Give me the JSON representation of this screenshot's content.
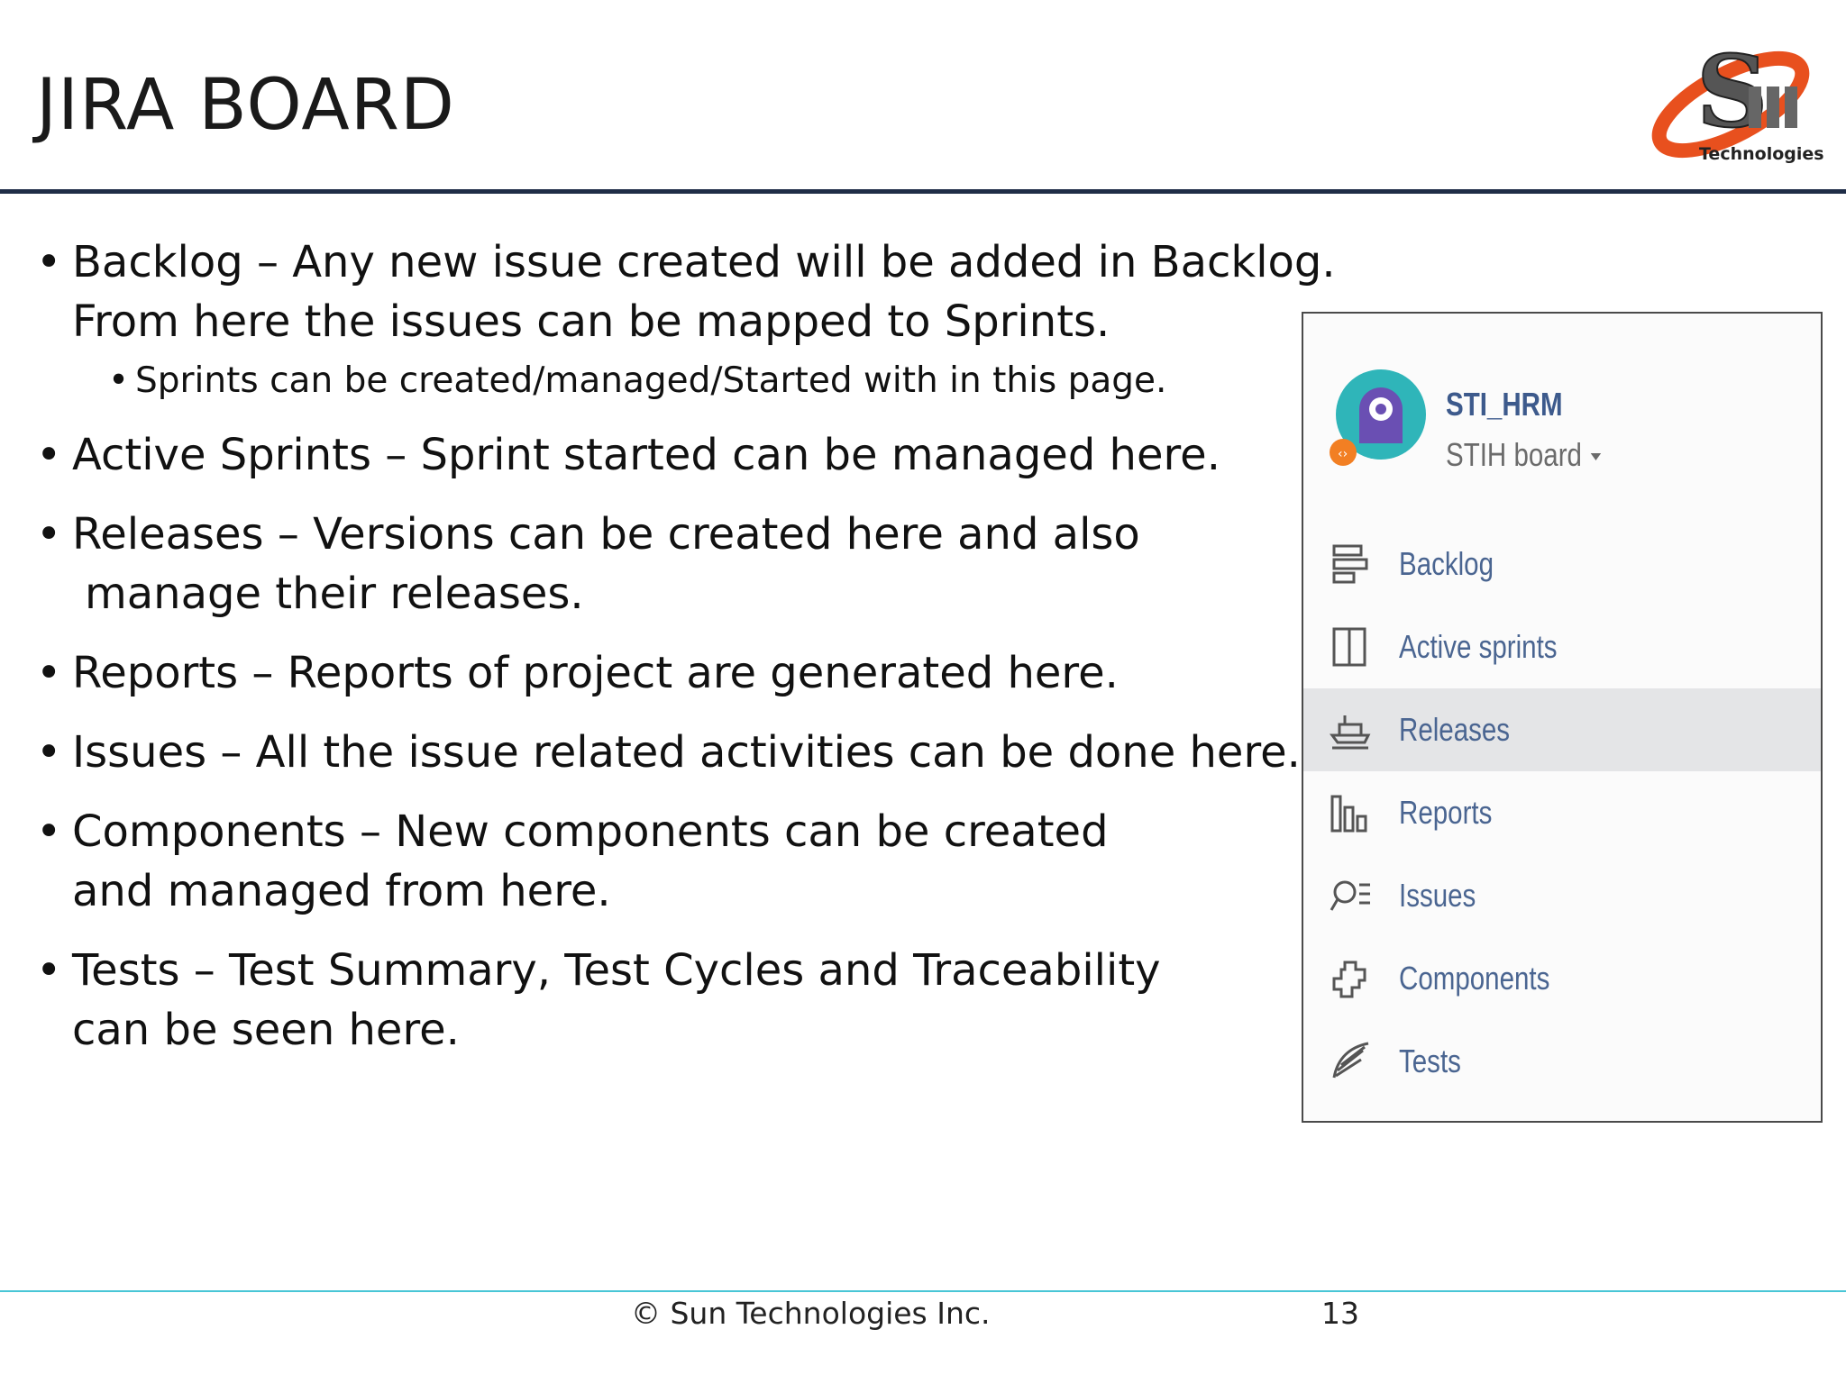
{
  "slide": {
    "title": "JIRA BOARD",
    "logo_caption": "Technologies"
  },
  "bullets": [
    {
      "lines": [
        "Backlog – Any new issue created will be added in Backlog.",
        "From here the issues can be mapped to Sprints."
      ]
    },
    {
      "sub": "Sprints can be created/managed/Started with in this page."
    },
    {
      "lines": [
        "Active Sprints – Sprint started can be managed here."
      ]
    },
    {
      "lines": [
        "Releases – Versions can be created here and also",
        "manage their releases."
      ]
    },
    {
      "lines": [
        "Reports – Reports of project are generated here."
      ]
    },
    {
      "lines": [
        "Issues – All the issue related activities can be done here."
      ]
    },
    {
      "lines": [
        "Components – New components can be created",
        "and managed from here."
      ]
    },
    {
      "lines": [
        "Tests – Test Summary, Test Cycles and Traceability",
        "can be seen here."
      ]
    }
  ],
  "jira_panel": {
    "project_name": "STI_HRM",
    "board_name": "STIH board",
    "selected_item": "Releases",
    "nav": [
      {
        "label": "Backlog",
        "icon": "backlog-icon"
      },
      {
        "label": "Active sprints",
        "icon": "active-sprints-icon"
      },
      {
        "label": "Releases",
        "icon": "releases-icon"
      },
      {
        "label": "Reports",
        "icon": "reports-icon"
      },
      {
        "label": "Issues",
        "icon": "issues-icon"
      },
      {
        "label": "Components",
        "icon": "components-icon"
      },
      {
        "label": "Tests",
        "icon": "tests-icon"
      }
    ]
  },
  "footer": {
    "copyright": "© Sun Technologies Inc.",
    "page_number": "13"
  },
  "colors": {
    "title_rule": "#1f2d47",
    "footer_rule": "#48c6d6",
    "nav_text": "#4a6591",
    "project_name": "#3d5a8c",
    "selected_row": "#e4e5e7",
    "logo_orange": "#e8501e"
  }
}
